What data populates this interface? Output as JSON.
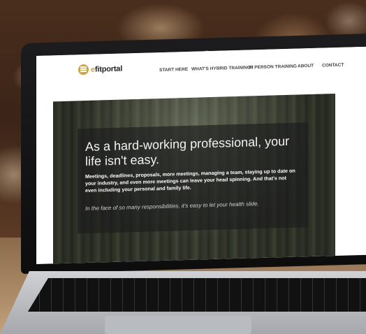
{
  "logo": {
    "prefix": "e",
    "text": "fitportal"
  },
  "nav": {
    "items": [
      "START HERE",
      "WHAT'S HYBRID TRAINING?",
      "IN PERSON TRAINING",
      "ABOUT",
      "CONTACT"
    ]
  },
  "hero": {
    "headline": "As a hard-working professional, your life isn't easy.",
    "paragraph": "Meetings, deadlines, proposals, more meetings, managing a team, staying up to date on your industry, and even more meetings can leave your head spinning. And that's not even including your personal and family life.",
    "tagline": "In the face of so many responsibilities, it's easy to let your health slide."
  }
}
